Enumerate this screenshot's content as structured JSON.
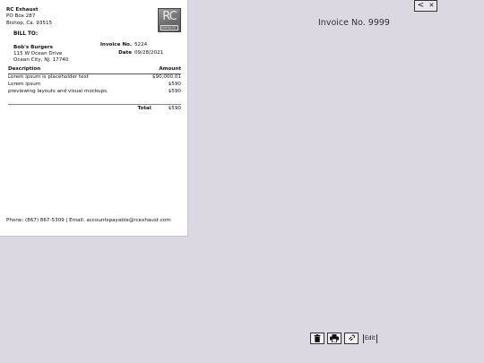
{
  "company": {
    "name": "RC Exhaust",
    "address1": "PO Box 287",
    "address2": "Bishop, Ca. 93515",
    "logo_main": "RC",
    "logo_sub": "EXHAUST"
  },
  "bill_to": {
    "heading": "BILL TO:",
    "name": "Bob's Burgers",
    "street": "115 W Ocean Drive",
    "city": "Ocean City, NJ. 17740"
  },
  "invoice": {
    "no_label": "Invoice No.",
    "no_value": "5224",
    "date_label": "Date",
    "date_value": "09/28/2021"
  },
  "table": {
    "col_description": "Description",
    "col_amount": "Amount",
    "rows": [
      {
        "description": "Lorem ipsum is placeholder text",
        "amount": "$90,000.01"
      },
      {
        "description": "Lorem ipsum",
        "amount": "$590"
      },
      {
        "description": "previewing layouts and visual mockups.",
        "amount": "$590"
      }
    ],
    "total_label": "Total",
    "total_value": "$590"
  },
  "footer": "Phone: (867) 867-5309 | Email: accountspayable@rcexhaust.com",
  "viewer": {
    "title": "Invoice No. 9999",
    "back_glyph": "<",
    "close_glyph": "✕",
    "edit_label": "Edit"
  },
  "icons": {
    "back": "chevron-left-icon",
    "close": "close-icon",
    "delete": "trash-icon",
    "print": "printer-icon",
    "link": "link-icon"
  }
}
